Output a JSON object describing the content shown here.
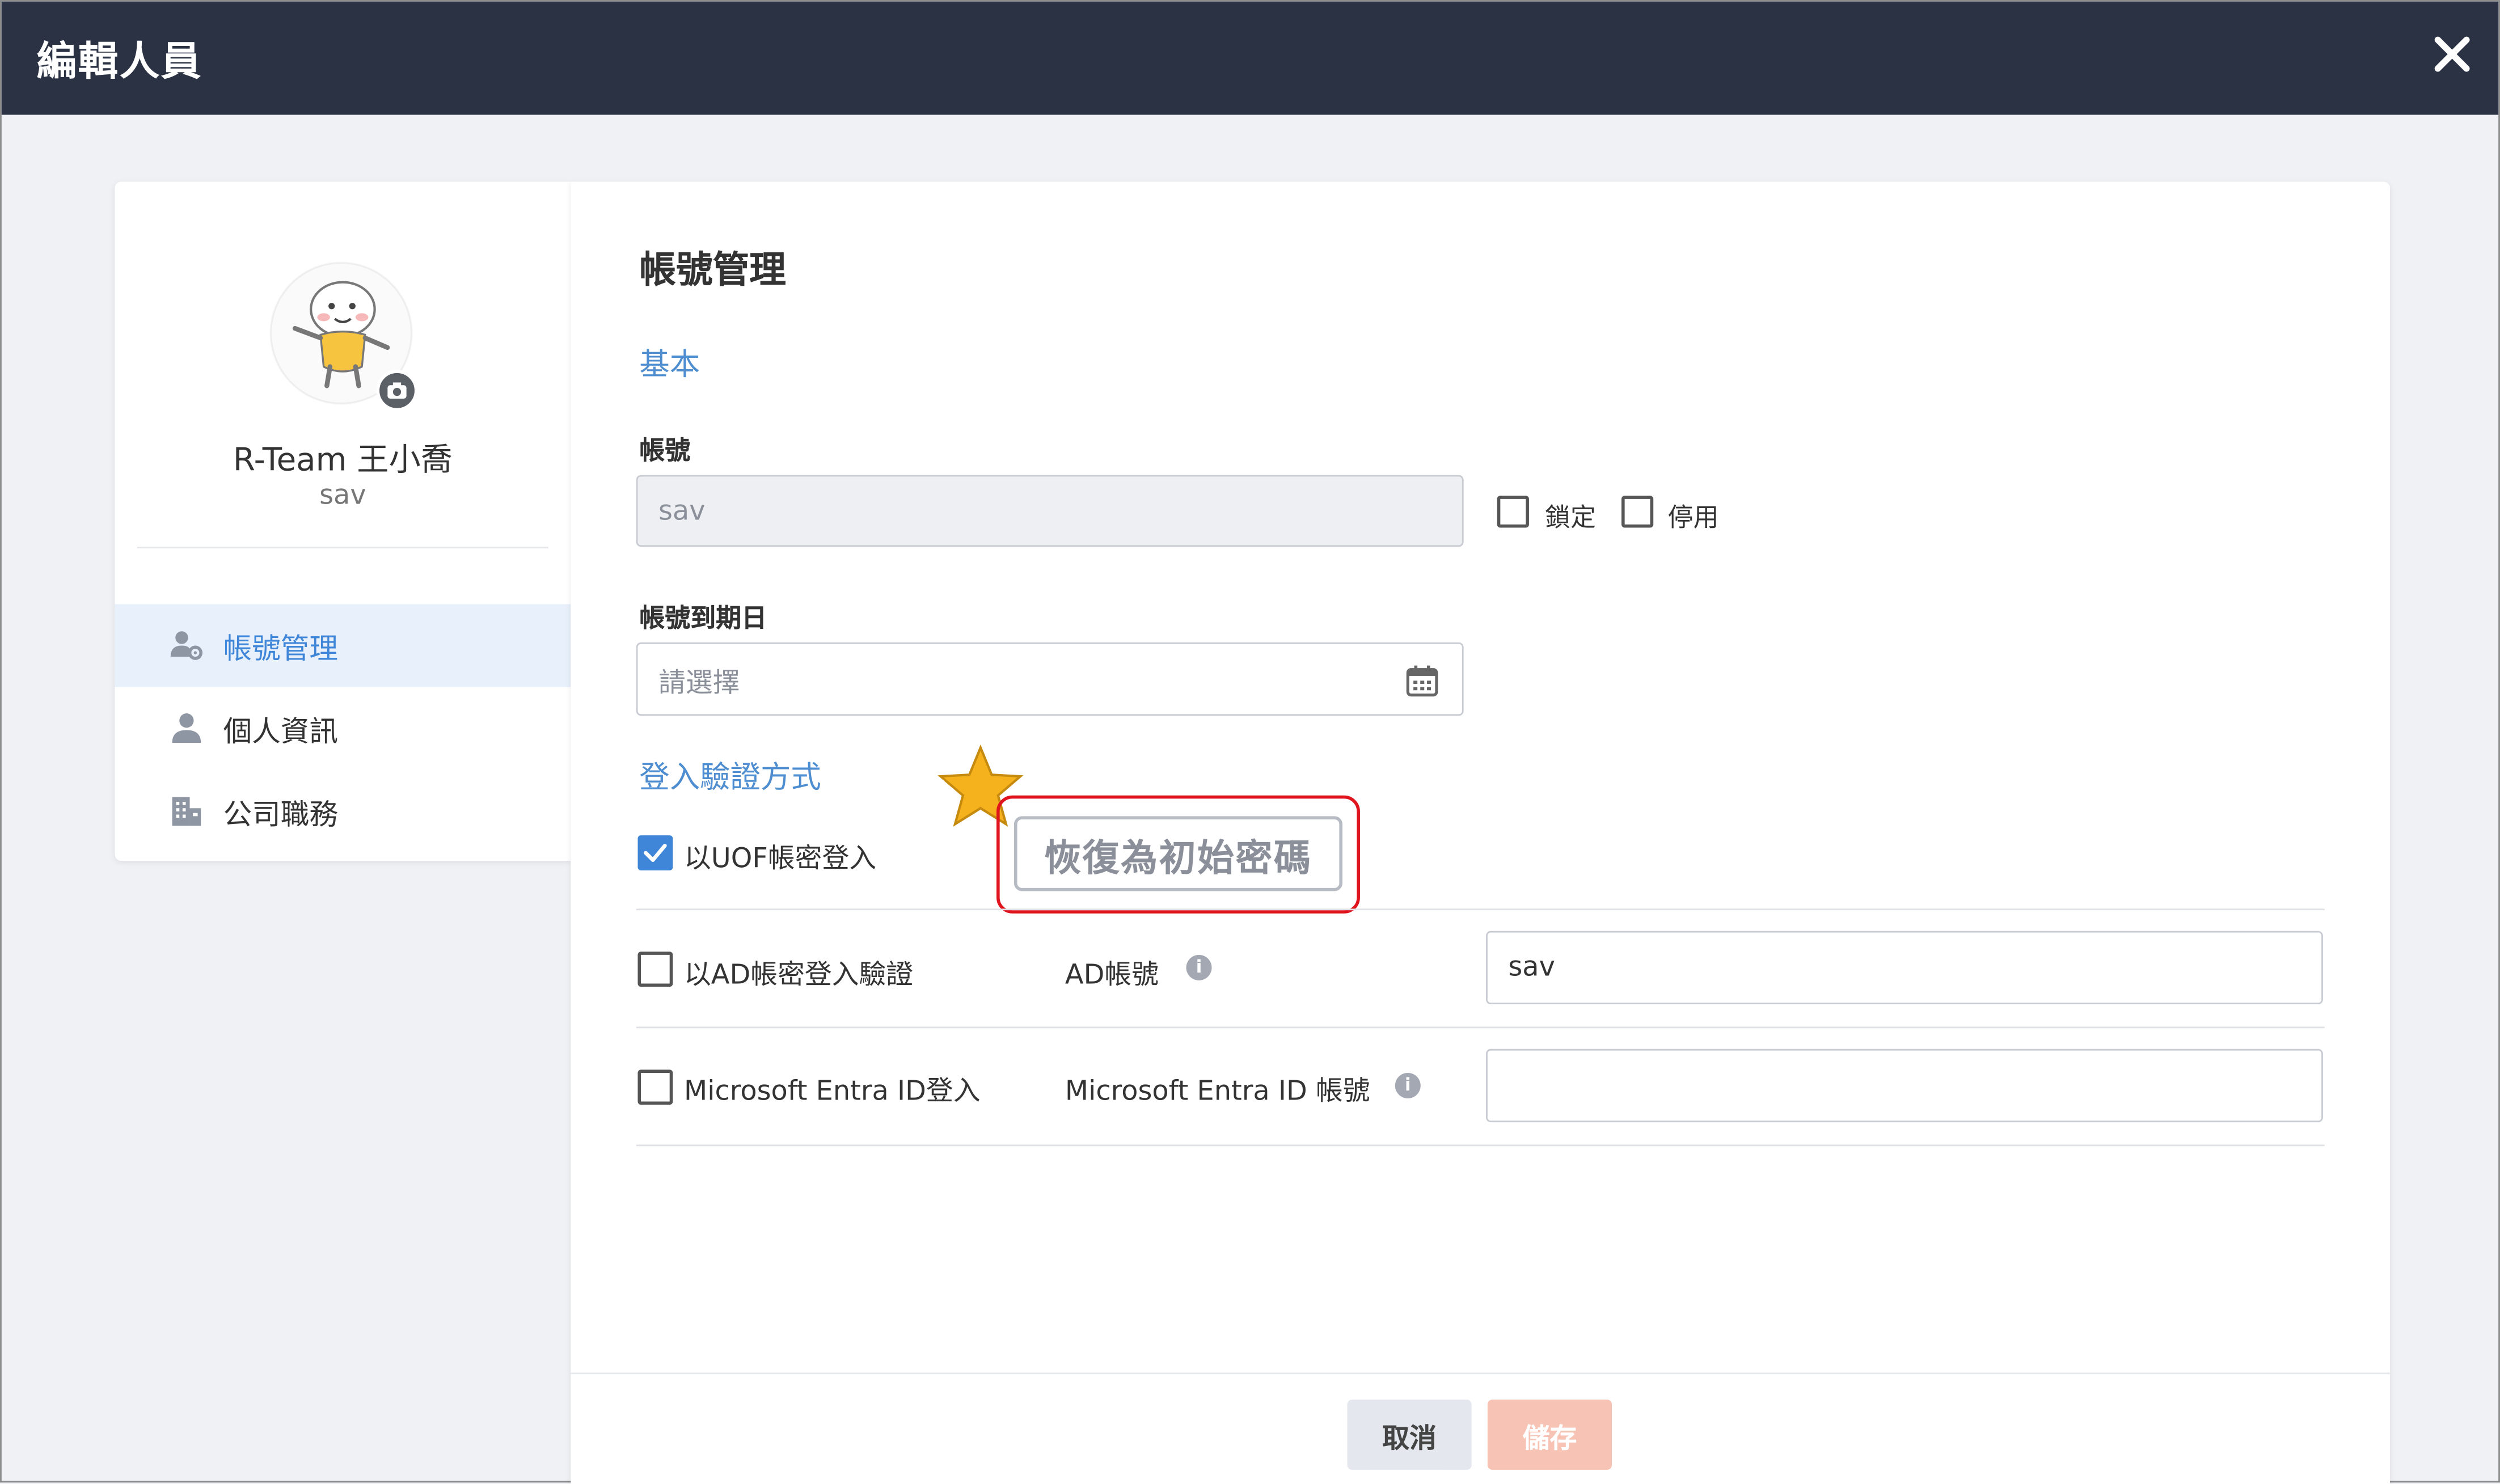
{
  "window": {
    "title": "編輯人員"
  },
  "profile": {
    "name": "R-Team 王小喬",
    "account": "sav"
  },
  "sidebar": {
    "items": [
      {
        "label": "帳號管理",
        "icon": "user-gear-icon",
        "active": true
      },
      {
        "label": "個人資訊",
        "icon": "person-icon",
        "active": false
      },
      {
        "label": "公司職務",
        "icon": "building-icon",
        "active": false
      }
    ]
  },
  "main": {
    "section_title": "帳號管理",
    "basic_label": "基本",
    "account_label": "帳號",
    "account_value": "sav",
    "lock_label": "鎖定",
    "disable_label": "停用",
    "expiry_label": "帳號到期日",
    "expiry_placeholder": "請選擇",
    "auth_label": "登入驗證方式",
    "uof_login_label": "以UOF帳密登入",
    "reset_password_label": "恢復為初始密碼",
    "ad_login_label": "以AD帳密登入驗證",
    "ad_account_label": "AD帳號",
    "ad_account_value": "sav",
    "entra_login_label": "Microsoft Entra ID登入",
    "entra_account_label": "Microsoft Entra ID 帳號",
    "entra_account_value": ""
  },
  "footer": {
    "cancel_label": "取消",
    "save_label": "儲存"
  },
  "colors": {
    "header_bg": "#2b3244",
    "accent": "#3f86d9",
    "highlight": "#e0141c",
    "save_bg": "#f7c3b4"
  }
}
